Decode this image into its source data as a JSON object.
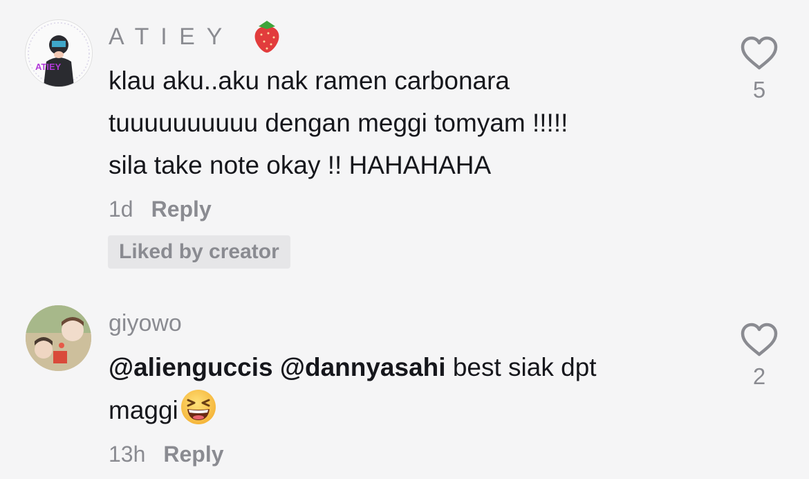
{
  "comments": [
    {
      "username": "A T I E Y",
      "avatar_label": "ATIEY",
      "lines": [
        "klau aku..aku nak ramen carbonara",
        "tuuuuuuuuuu dengan meggi tomyam !!!!!",
        "sila take note okay !! HAHAHAHA"
      ],
      "time": "1d",
      "reply_label": "Reply",
      "badge": "Liked by creator",
      "likes": "5",
      "username_emoji": "strawberry-icon"
    },
    {
      "username": "giyowo",
      "mentions": [
        "@alienguccis",
        "@dannyasahi"
      ],
      "text_after_mentions": "best siak dpt",
      "text_line2": "maggi",
      "trailing_emoji": "grinning-squinting-face-icon",
      "time": "13h",
      "reply_label": "Reply",
      "likes": "2"
    }
  ],
  "colors": {
    "background": "#f5f5f6",
    "secondary_text": "#8a8b91",
    "primary_text": "#16171c",
    "badge_bg": "#e6e6e8"
  }
}
